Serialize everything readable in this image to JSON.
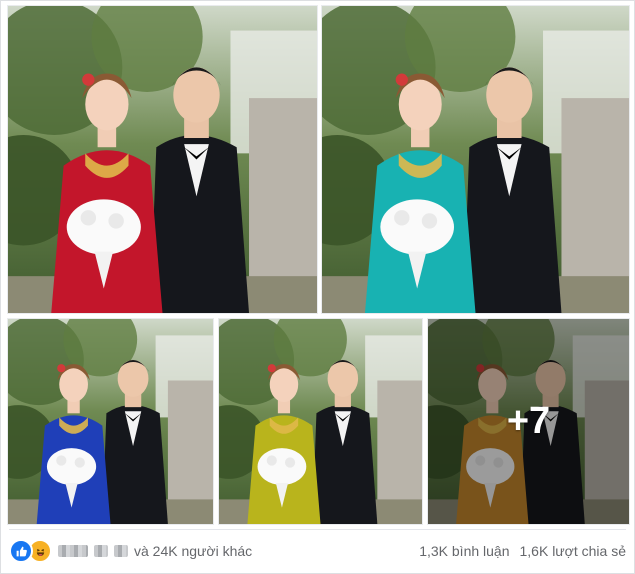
{
  "post": {
    "photos": [
      {
        "dress": "#c3162b",
        "alt": "couple-red-dress"
      },
      {
        "dress": "#18b2b2",
        "alt": "couple-teal-dress"
      },
      {
        "dress": "#1f3fb8",
        "alt": "couple-blue-dress"
      },
      {
        "dress": "#b9b41c",
        "alt": "couple-yellow-dress"
      },
      {
        "dress": "#c4862d",
        "alt": "couple-orange-dress"
      }
    ],
    "more_photos_label": "+7"
  },
  "reactions": {
    "icons": [
      "like-icon",
      "haha-icon"
    ],
    "like_color": "#1877f2",
    "haha_color": "#f7b125",
    "others_text": "và 24K người khác",
    "comments_text": "1,3K bình luận",
    "shares_text": "1,6K lượt chia sẻ"
  }
}
